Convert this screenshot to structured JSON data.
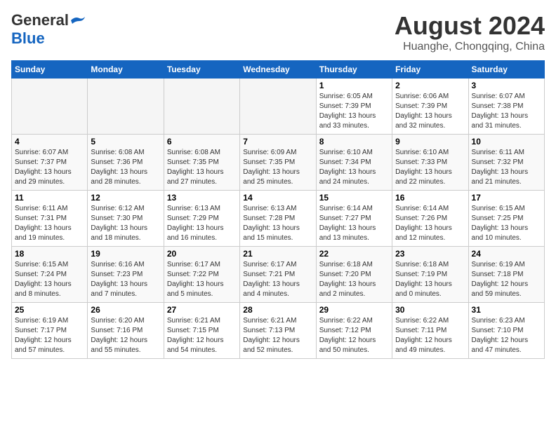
{
  "header": {
    "logo": {
      "general": "General",
      "blue": "Blue",
      "bird_unicode": "🔵"
    },
    "title": "August 2024",
    "location": "Huanghe, Chongqing, China"
  },
  "days_of_week": [
    "Sunday",
    "Monday",
    "Tuesday",
    "Wednesday",
    "Thursday",
    "Friday",
    "Saturday"
  ],
  "weeks": [
    [
      {
        "day": "",
        "info": ""
      },
      {
        "day": "",
        "info": ""
      },
      {
        "day": "",
        "info": ""
      },
      {
        "day": "",
        "info": ""
      },
      {
        "day": "1",
        "info": "Sunrise: 6:05 AM\nSunset: 7:39 PM\nDaylight: 13 hours and 33 minutes."
      },
      {
        "day": "2",
        "info": "Sunrise: 6:06 AM\nSunset: 7:39 PM\nDaylight: 13 hours and 32 minutes."
      },
      {
        "day": "3",
        "info": "Sunrise: 6:07 AM\nSunset: 7:38 PM\nDaylight: 13 hours and 31 minutes."
      }
    ],
    [
      {
        "day": "4",
        "info": "Sunrise: 6:07 AM\nSunset: 7:37 PM\nDaylight: 13 hours and 29 minutes."
      },
      {
        "day": "5",
        "info": "Sunrise: 6:08 AM\nSunset: 7:36 PM\nDaylight: 13 hours and 28 minutes."
      },
      {
        "day": "6",
        "info": "Sunrise: 6:08 AM\nSunset: 7:35 PM\nDaylight: 13 hours and 27 minutes."
      },
      {
        "day": "7",
        "info": "Sunrise: 6:09 AM\nSunset: 7:35 PM\nDaylight: 13 hours and 25 minutes."
      },
      {
        "day": "8",
        "info": "Sunrise: 6:10 AM\nSunset: 7:34 PM\nDaylight: 13 hours and 24 minutes."
      },
      {
        "day": "9",
        "info": "Sunrise: 6:10 AM\nSunset: 7:33 PM\nDaylight: 13 hours and 22 minutes."
      },
      {
        "day": "10",
        "info": "Sunrise: 6:11 AM\nSunset: 7:32 PM\nDaylight: 13 hours and 21 minutes."
      }
    ],
    [
      {
        "day": "11",
        "info": "Sunrise: 6:11 AM\nSunset: 7:31 PM\nDaylight: 13 hours and 19 minutes."
      },
      {
        "day": "12",
        "info": "Sunrise: 6:12 AM\nSunset: 7:30 PM\nDaylight: 13 hours and 18 minutes."
      },
      {
        "day": "13",
        "info": "Sunrise: 6:13 AM\nSunset: 7:29 PM\nDaylight: 13 hours and 16 minutes."
      },
      {
        "day": "14",
        "info": "Sunrise: 6:13 AM\nSunset: 7:28 PM\nDaylight: 13 hours and 15 minutes."
      },
      {
        "day": "15",
        "info": "Sunrise: 6:14 AM\nSunset: 7:27 PM\nDaylight: 13 hours and 13 minutes."
      },
      {
        "day": "16",
        "info": "Sunrise: 6:14 AM\nSunset: 7:26 PM\nDaylight: 13 hours and 12 minutes."
      },
      {
        "day": "17",
        "info": "Sunrise: 6:15 AM\nSunset: 7:25 PM\nDaylight: 13 hours and 10 minutes."
      }
    ],
    [
      {
        "day": "18",
        "info": "Sunrise: 6:15 AM\nSunset: 7:24 PM\nDaylight: 13 hours and 8 minutes."
      },
      {
        "day": "19",
        "info": "Sunrise: 6:16 AM\nSunset: 7:23 PM\nDaylight: 13 hours and 7 minutes."
      },
      {
        "day": "20",
        "info": "Sunrise: 6:17 AM\nSunset: 7:22 PM\nDaylight: 13 hours and 5 minutes."
      },
      {
        "day": "21",
        "info": "Sunrise: 6:17 AM\nSunset: 7:21 PM\nDaylight: 13 hours and 4 minutes."
      },
      {
        "day": "22",
        "info": "Sunrise: 6:18 AM\nSunset: 7:20 PM\nDaylight: 13 hours and 2 minutes."
      },
      {
        "day": "23",
        "info": "Sunrise: 6:18 AM\nSunset: 7:19 PM\nDaylight: 13 hours and 0 minutes."
      },
      {
        "day": "24",
        "info": "Sunrise: 6:19 AM\nSunset: 7:18 PM\nDaylight: 12 hours and 59 minutes."
      }
    ],
    [
      {
        "day": "25",
        "info": "Sunrise: 6:19 AM\nSunset: 7:17 PM\nDaylight: 12 hours and 57 minutes."
      },
      {
        "day": "26",
        "info": "Sunrise: 6:20 AM\nSunset: 7:16 PM\nDaylight: 12 hours and 55 minutes."
      },
      {
        "day": "27",
        "info": "Sunrise: 6:21 AM\nSunset: 7:15 PM\nDaylight: 12 hours and 54 minutes."
      },
      {
        "day": "28",
        "info": "Sunrise: 6:21 AM\nSunset: 7:13 PM\nDaylight: 12 hours and 52 minutes."
      },
      {
        "day": "29",
        "info": "Sunrise: 6:22 AM\nSunset: 7:12 PM\nDaylight: 12 hours and 50 minutes."
      },
      {
        "day": "30",
        "info": "Sunrise: 6:22 AM\nSunset: 7:11 PM\nDaylight: 12 hours and 49 minutes."
      },
      {
        "day": "31",
        "info": "Sunrise: 6:23 AM\nSunset: 7:10 PM\nDaylight: 12 hours and 47 minutes."
      }
    ]
  ],
  "colors": {
    "header_bg": "#1565c0",
    "header_text": "#ffffff",
    "even_row_bg": "#f9f9f9",
    "odd_row_bg": "#ffffff",
    "empty_bg": "#f5f5f5"
  }
}
